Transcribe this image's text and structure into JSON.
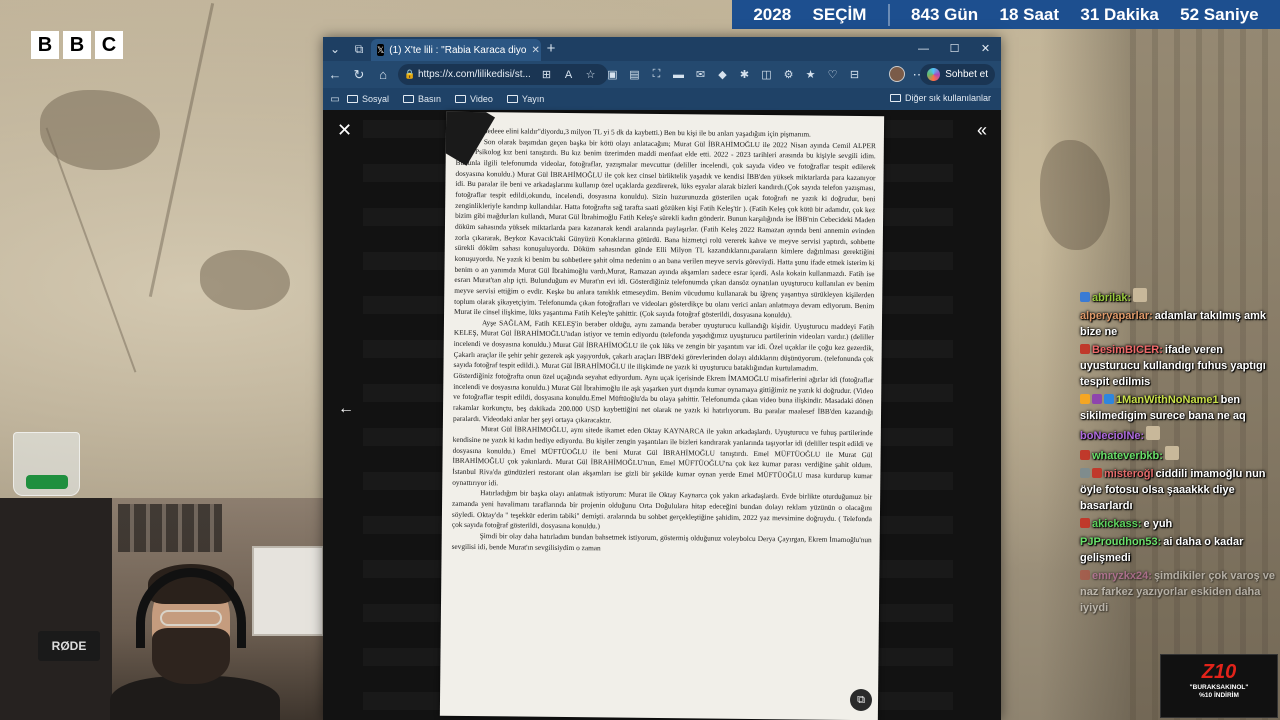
{
  "broadcaster": {
    "logo_letters": [
      "B",
      "B",
      "C"
    ]
  },
  "countdown": {
    "year": "2028",
    "label": "SEÇİM",
    "days": "843 Gün",
    "hours": "18 Saat",
    "minutes": "31 Dakika",
    "seconds": "52 Saniye",
    "bg_color": "#1d4f8f"
  },
  "webcam": {
    "mic_brand": "RØDE"
  },
  "browser": {
    "tab": {
      "title": "(1) X'te lili   : \"Rabia Karaca diyo",
      "icon": "x-logo"
    },
    "window_controls": [
      "minimize-icon",
      "maximize-icon",
      "close-icon"
    ],
    "url": "https://x.com/lilikedisi/st...",
    "chat_button": "Sohbet et",
    "favorites": [
      "Sosyal",
      "Basın",
      "Video",
      "Yayın"
    ],
    "favorites_other": "Diğer sık kullanılanlar"
  },
  "document": {
    "paragraphs": [
      "bakarak \"dedeee elini kaldır\"diyordu,3 milyon TL yi 5 dk da kaybetti.) Ben bu kişi ile bu anları yaşadığım için pişmanım.",
      "Son olarak başımdan geçen başka bir kötü olayı anlatacağım; Murat Gül İBRAHİMOĞLU ile 2022 Nisan ayında Cemil ALPER isimli Psikolog kız beni tanıştırdı. Bu kız benim üzerimden maddi menfaat elde etti. 2022 - 2023 tarihleri arasında bu kişiyle sevgili idim. Bununla ilgili telefonumda videolar, fotoğraflar, yazışmalar mevcuttur (deliller incelendi, çok sayıda video ve fotoğraflar tespit edilerek dosyasına konuldu.) Murat Gül İBRAHİMOĞLU ile çok kez cinsel birliktelik yaşadık ve kendisi İBB'den yüksek miktarlarda para kazanıyor idi. Bu paralar ile beni ve arkadaşlarımı kullanıp özel uçaklarda gezdirerek, lüks eşyalar alarak bizleri kandırdı.(Çok sayıda telefon yazışması, fotoğraflar tespit edildi,okundu, incelendi, dosyasına konuldu). Sizin huzurunuzda gösterilen uçak fotoğrafı ne yazık ki doğrudur, beni zenginlikleriyle kandırıp kullandılar. Hatta fotoğrafta sağ tarafta saati gözüken kişi Fatih Keleş'tir ). (Fatih Keleş çok kötü bir adamdır, çok kez bizim gibi mağdurları kullandı, Murat Gül İbrahimoğlu Fatih Keleş'e sürekli kadın gönderir. Bunun karşılığında ise İBB'nin Cebecideki Maden döküm sahasında yüksek miktarlarda para kazanarak kendi aralarında paylaşırlar. (Fatih Keleş 2022 Ramazan ayında beni annemin evinden zorla çıkararak, Beykoz Kavacık'taki Günyüzü Konaklarına götürdü. Bana hizmetçi rolü vererek kahve ve meyve servisi yaptırdı, sohbette sürekli döküm sahası konuşuluyordu. Döküm sahasından günde Elli Milyon TL kazandıklarını,paraların kimlere dağıtılması gerektiğini konuşuyordu. Ne yazık ki benim bu sohbetlere şahit olma nedenim o an bana verilen meyve servis göreviydi. Hatta şunu ifade etmek isterim ki benim o an yanımda Murat Gül İbrahimoğlu vardı,Murat, Ramazan ayında akşamları sadece esrar içerdi. Asla kokain kullanmazdı. Fatih ise esrarı Murat'tan alıp içti. Bulunduğum ev Murat'ın evi idi. Gösterdiğiniz telefonumda çıkan dansöz oynatılan uyuşturucu kullanılan ev benim meyve servisi ettiğim o evdir. Keşke bu anlara tanıklık etmeseydim. Benim vücudumu kullanarak bu iğrenç yaşantıya sürükleyen kişilerden toplum olarak şikayetçiyim. Telefonumda çıkan fotoğrafları ve videoları gösterdikçe bu olanı verici anları anlatmaya devam ediyorum. Benim Murat ile cinsel ilişkime, lüks yaşantıma Fatih Keleş'te şahittir. (Çok sayıda fotoğraf gösterildi, dosyasına konuldu).",
      "Ayşe SAĞLAM, Fatih KELEŞ'in beraber olduğu, aynı zamanda beraber uyuşturucu kullandığı kişidir. Uyuşturucu maddeyi Fatih KELEŞ, Murat Gül İBRAHİMOĞLU'ndan istiyor ve temin ediyordu (telefonda yaşadığımız uyuşturucu partilerinin videoları vardır.) (deliller incelendi ve dosyasına konuldu.) Murat Gül İBRAHİMOĞLU ile çok lüks ve zengin bir yaşantım var idi. Özel uçaklar ile çoğu kez gezerdik, Çakarlı araçlar ile şehir şehir gezerek aşk yaşıyorduk, çakarlı araçları İBB'deki görevlerinden dolayı aldıklarını düşünüyorum. (telefonunda çok sayıda fotoğraf tespit edildi.). Murat Gül İBRAHİMOĞLU ile ilişkimde ne yazık ki uyuşturucu bataklığından kurtulamadım.",
      "Gösterdiğiniz fotoğrafta onun özel uçağında seyahat ediyordum. Aynı uçak içerisinde Ekrem İMAMOĞLU misafirlerini ağırlar idi (fotoğraflar incelendi ve dosyasına konuldu.) Murat Gül İbrahimoğlu ile aşk yaşarken yurt dışında kumar oynamaya gittiğimiz ne yazık ki doğrudur. (Video ve fotoğraflar tespit edildi, dosyasına konuldu.Emel Müftüoğlu'da bu olaya şahittir. Telefonumda çıkan video buna ilişkindir. Masadaki dönen rakamlar korkunçtu, beş dakikada 200.000 USD kaybettiğini net olarak ne yazık ki hatırlıyorum. Bu paralar maalesef İBB'den kazandığı paralardı. Videodaki anlar her şeyi ortaya çıkaracaktır.",
      "Murat Gül İBRAHİMOĞLU, aynı sitede ikamet eden Oktay KAYNARCA ile yakın arkadaşlardı. Uyuşturucu ve fuhuş partilerinde kendisine ne yazık ki kadın hediye ediyordu. Bu kişiler zengin yaşantıları ile bizleri kandırarak yanlarında taşıyorlar idi (deliller tespit edildi ve dosyasına konuldu.) Emel MÜFTÜOĞLU ile beni Murat Gül İBRAHİMOĞLU tanıştırdı. Emel MÜFTÜOĞLU ile Murat Gül İBRAHİMOĞLU çok yakınlardı. Murat Gül İBRAHİMOĞLU'nun, Emel MÜFTÜOĞLU'na çok kez kumar parası verdiğine şahit oldum. İstanbul Riva'da gündüzleri restorant olan akşamları ise gizli bir şekilde kumar oynan yerde Emel MÜFTÜOĞLU masa kurdurup kumar oynattırıyor idi.",
      "Hatırladığım bir başka olayı anlatmak istiyorum: Murat ile Oktay Kaynarca çok yakın arkadaşlardı. Evde birlikte oturduğumuz bir zamanda yeni havalimanı taraflarında bir projenin olduğunu Orta Doğululara hitap edeceğini bundan dolayı reklam yüzünün o olacağını söyledi. Oktay'da \" teşekkür ederim tabiki\" demişti. aralarında bu sohbet gerçekleştiğine şahidim, 2022 yaz mevsimine doğruydu. ( Telefonda çok sayıda fotoğraf gösterildi, dosyasına konuldu.)",
      "Şimdi bir olay daha hatırladım bundan bahsetmek istiyorum, göstermiş olduğunuz voleybolcu Derya Çayırgan, Ekrem İmamoğlu'nun sevgilisi idi, bende Murat'ın sevgilisiydim o zaman"
    ]
  },
  "chat": {
    "messages": [
      {
        "user": "abrilak:",
        "text": "",
        "user_color": "#9ac93f",
        "badges": [
          "#3a7bd5"
        ],
        "emote": true
      },
      {
        "user": "alperyaparlar:",
        "text": "adamlar takılmış amk bize ne",
        "user_color": "#e09b6b",
        "badges": []
      },
      {
        "user": "BesimBICER:",
        "text": "ifade veren uyusturucu kullandıgı fuhus yaptıgı tespit edilmis",
        "user_color": "#f06a6a",
        "badges": [
          "#c0392b"
        ]
      },
      {
        "user": "1ManWithNoName1",
        "text": "ben sikilmedigim surece bana ne aq",
        "user_color": "#c9e04a",
        "badges": [
          "#f5a623",
          "#8e44ad",
          "#2e86de"
        ]
      },
      {
        "user": "boNeciolNe:",
        "text": "",
        "user_color": "#b06be0",
        "badges": [],
        "emote": true
      },
      {
        "user": "whateverbkb:",
        "text": "",
        "user_color": "#6adf6a",
        "badges": [
          "#c0392b"
        ],
        "emote": true
      },
      {
        "user": "misteroğl",
        "text": "ciddili imamoğlu nun öyle fotosu olsa şaaakkk diye basarlardı",
        "user_color": "#e36b6b",
        "badges": [
          "#7f8c8d",
          "#c0392b"
        ]
      },
      {
        "user": "akickass:",
        "text": "e yuh",
        "user_color": "#5fd35f",
        "badges": [
          "#c0392b"
        ]
      },
      {
        "user": "PJProudhon53:",
        "text": "ai daha o kadar gelişmedi",
        "user_color": "#6be06b",
        "badges": []
      },
      {
        "user": "emryzkx24:",
        "text": "şimdikiler çok varoş ve naz farkez yazıyorlar eskiden daha iyiydi",
        "user_color": "#e06bbf",
        "badges": [
          "#c0392b"
        ],
        "fade": true
      }
    ]
  },
  "promo": {
    "logo": "Z10",
    "line1": "\"BURAKSAKINOL\"",
    "line2": "%10 İNDİRİM"
  }
}
